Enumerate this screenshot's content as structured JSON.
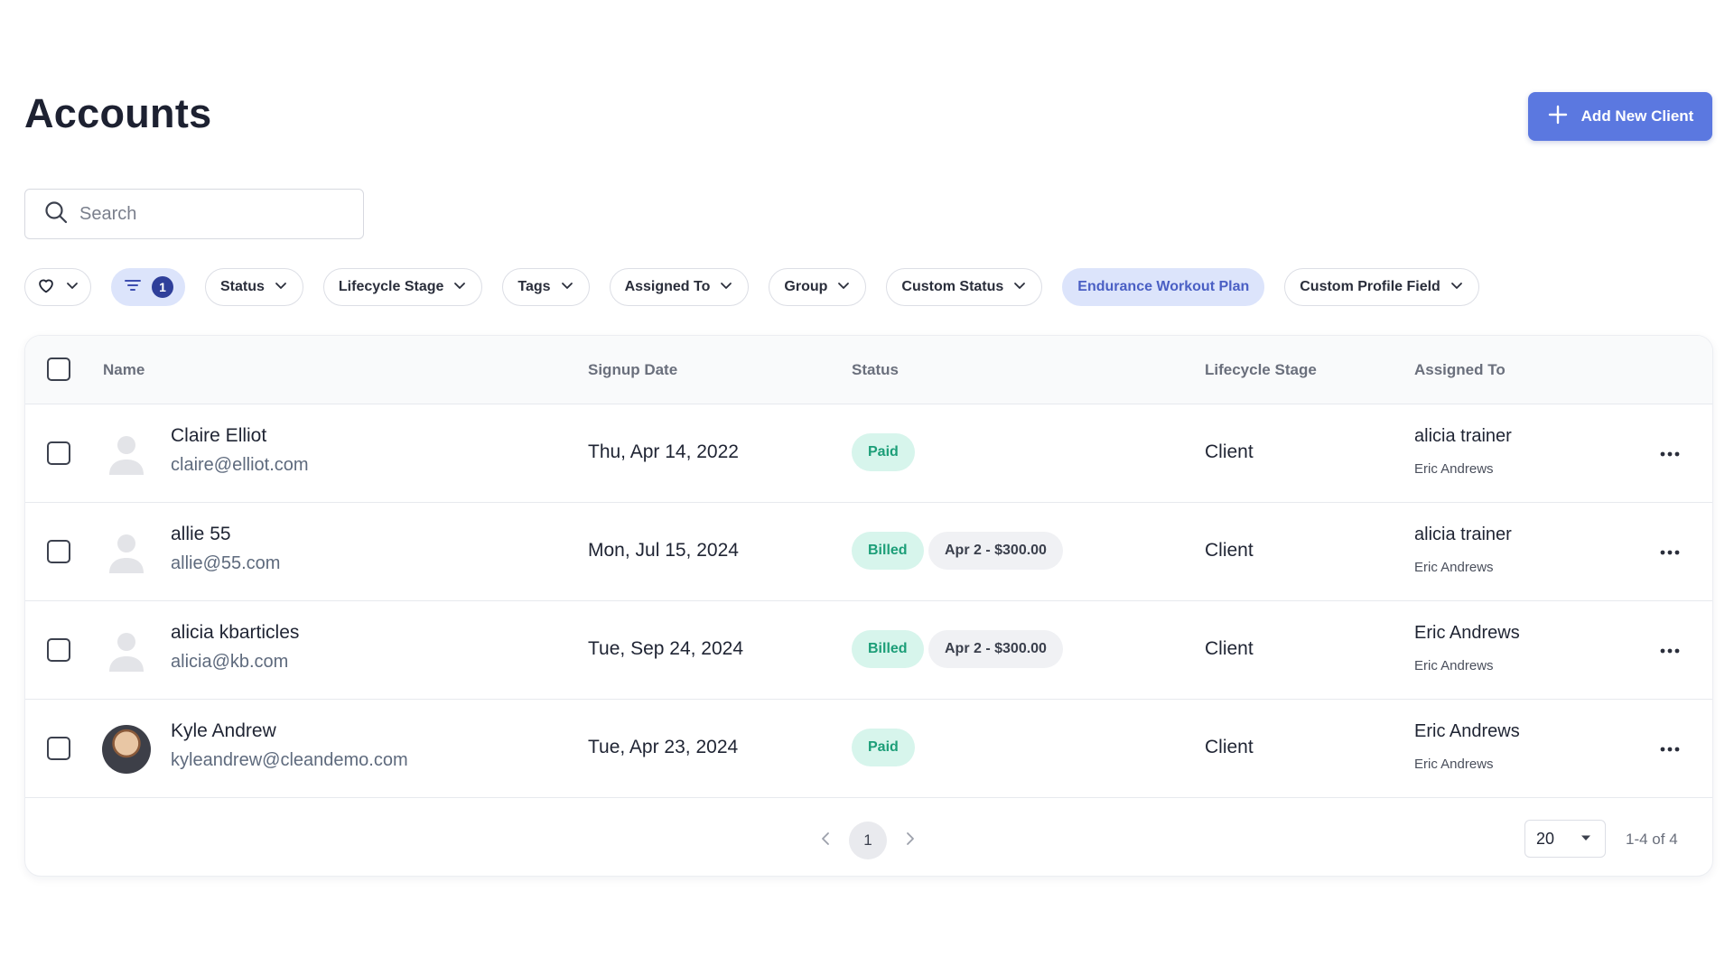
{
  "page": {
    "title": "Accounts"
  },
  "header": {
    "add_button_label": "Add New Client"
  },
  "search": {
    "placeholder": "Search",
    "value": ""
  },
  "filters": {
    "active_filter_count": "1",
    "chips": [
      {
        "label": "Status"
      },
      {
        "label": "Lifecycle Stage"
      },
      {
        "label": "Tags"
      },
      {
        "label": "Assigned To"
      },
      {
        "label": "Group"
      },
      {
        "label": "Custom Status"
      },
      {
        "label": "Endurance Workout Plan"
      },
      {
        "label": "Custom Profile Field"
      }
    ]
  },
  "table": {
    "columns": {
      "name": "Name",
      "signup": "Signup Date",
      "status": "Status",
      "stage": "Lifecycle Stage",
      "assigned": "Assigned To"
    },
    "rows": [
      {
        "name": "Claire Elliot",
        "email": "claire@elliot.com",
        "signup_date": "Thu, Apr 14, 2022",
        "status": "Paid",
        "amount": "",
        "stage": "Client",
        "assigned_to": "alicia trainer",
        "assigned_sub": "Eric Andrews",
        "avatar": "placeholder"
      },
      {
        "name": "allie 55",
        "email": "allie@55.com",
        "signup_date": "Mon, Jul 15, 2024",
        "status": "Billed",
        "amount": "Apr 2 - $300.00",
        "stage": "Client",
        "assigned_to": "alicia trainer",
        "assigned_sub": "Eric Andrews",
        "avatar": "placeholder"
      },
      {
        "name": "alicia kbarticles",
        "email": "alicia@kb.com",
        "signup_date": "Tue, Sep 24, 2024",
        "status": "Billed",
        "amount": "Apr 2 - $300.00",
        "stage": "Client",
        "assigned_to": "Eric Andrews",
        "assigned_sub": "Eric Andrews",
        "avatar": "placeholder"
      },
      {
        "name": "Kyle Andrew",
        "email": "kyleandrew@cleandemo.com",
        "signup_date": "Tue, Apr 23, 2024",
        "status": "Paid",
        "amount": "",
        "stage": "Client",
        "assigned_to": "Eric Andrews",
        "assigned_sub": "Eric Andrews",
        "avatar": "photo"
      }
    ]
  },
  "pagination": {
    "current_page": "1",
    "page_size": "20",
    "range_text": "1-4 of 4"
  },
  "colors": {
    "accent": "#5b78e0",
    "paid_bg": "#d7f5ec",
    "paid_text": "#1c9e78",
    "active_chip_bg": "#dce4fb"
  }
}
